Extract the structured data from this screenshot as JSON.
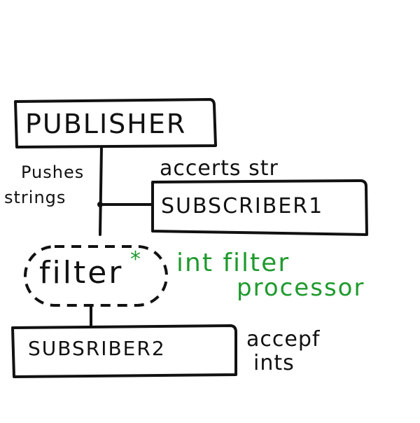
{
  "diagram": {
    "publisher": {
      "label": "PUBLISHER"
    },
    "subscriber1": {
      "label": "SUBSCRIBER1"
    },
    "subscriber2": {
      "label": "SUBSRIBER2"
    },
    "filter": {
      "label": "filter",
      "mark": "*"
    },
    "notes": {
      "pushes": "Pushes",
      "strings": "strings",
      "accepts_str": "accerts str",
      "accept": "accepf",
      "ints": "ints",
      "int_filter": "int filter",
      "processor": "processor"
    },
    "colors": {
      "ink": "#111111",
      "accent": "#1f9a2e"
    }
  }
}
